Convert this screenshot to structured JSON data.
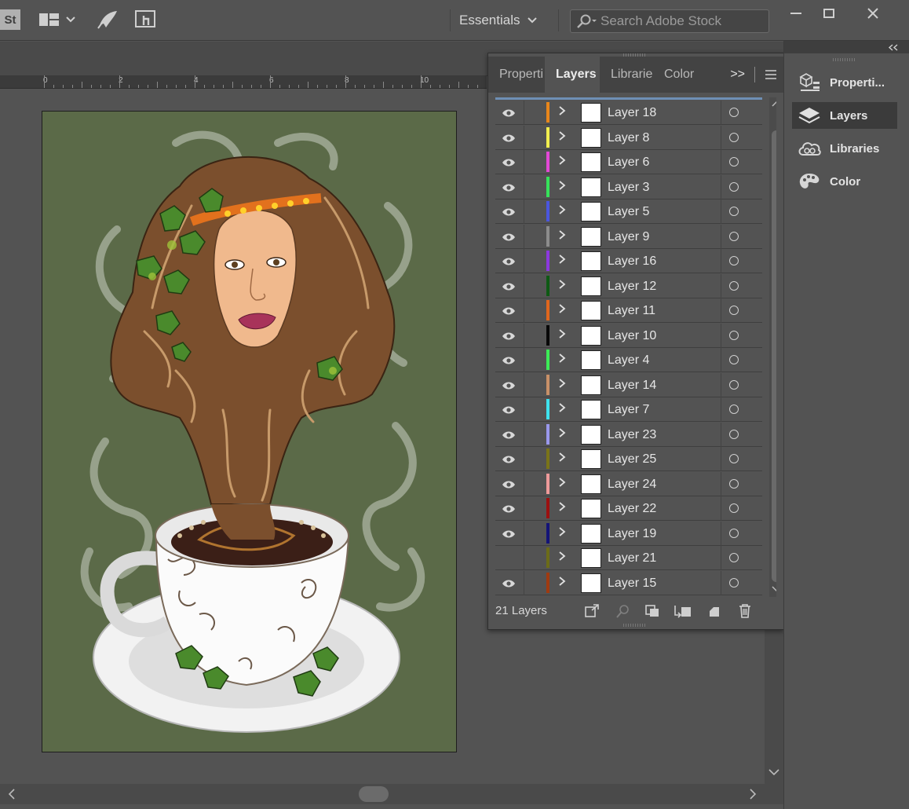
{
  "appbar": {
    "badge": "St",
    "workspace": "Essentials",
    "search_placeholder": "Search Adobe Stock"
  },
  "ruler": {
    "labels": [
      "0",
      "2",
      "4",
      "6",
      "8",
      "10"
    ]
  },
  "layers_panel": {
    "tabs": [
      "Properti",
      "Layers",
      "Libraries",
      "Color"
    ],
    "active_tab": "Layers",
    "overflow_label": ">>",
    "count_label": "21 Layers",
    "layers": [
      {
        "name": "Layer 18",
        "color": "#e8861a",
        "visible": true
      },
      {
        "name": "Layer 8",
        "color": "#f2ee4e",
        "visible": true
      },
      {
        "name": "Layer 6",
        "color": "#e448d6",
        "visible": true
      },
      {
        "name": "Layer 3",
        "color": "#36e25a",
        "visible": true
      },
      {
        "name": "Layer 5",
        "color": "#4a56de",
        "visible": true
      },
      {
        "name": "Layer 9",
        "color": "#8c8c8c",
        "visible": true
      },
      {
        "name": "Layer 16",
        "color": "#8c38de",
        "visible": true
      },
      {
        "name": "Layer 12",
        "color": "#0e5a14",
        "visible": true
      },
      {
        "name": "Layer 11",
        "color": "#e0661c",
        "visible": true
      },
      {
        "name": "Layer 10",
        "color": "#080808",
        "visible": true
      },
      {
        "name": "Layer 4",
        "color": "#3cec56",
        "visible": true
      },
      {
        "name": "Layer 14",
        "color": "#c89068",
        "visible": true
      },
      {
        "name": "Layer 7",
        "color": "#3ee2ee",
        "visible": true
      },
      {
        "name": "Layer 23",
        "color": "#9a98ec",
        "visible": true
      },
      {
        "name": "Layer 25",
        "color": "#7a7418",
        "visible": true
      },
      {
        "name": "Layer 24",
        "color": "#ee9a9a",
        "visible": true
      },
      {
        "name": "Layer 22",
        "color": "#9c1010",
        "visible": true
      },
      {
        "name": "Layer 19",
        "color": "#141478",
        "visible": true
      },
      {
        "name": "Layer 21",
        "color": "#6c6c18",
        "visible": false
      },
      {
        "name": "Layer 15",
        "color": "#a03a10",
        "visible": true
      }
    ]
  },
  "dock": {
    "items": [
      {
        "label": "Properti...",
        "icon": "properties-icon"
      },
      {
        "label": "Layers",
        "icon": "layers-icon"
      },
      {
        "label": "Libraries",
        "icon": "libraries-icon"
      },
      {
        "label": "Color",
        "icon": "color-palette-icon"
      }
    ],
    "active": "Layers"
  }
}
